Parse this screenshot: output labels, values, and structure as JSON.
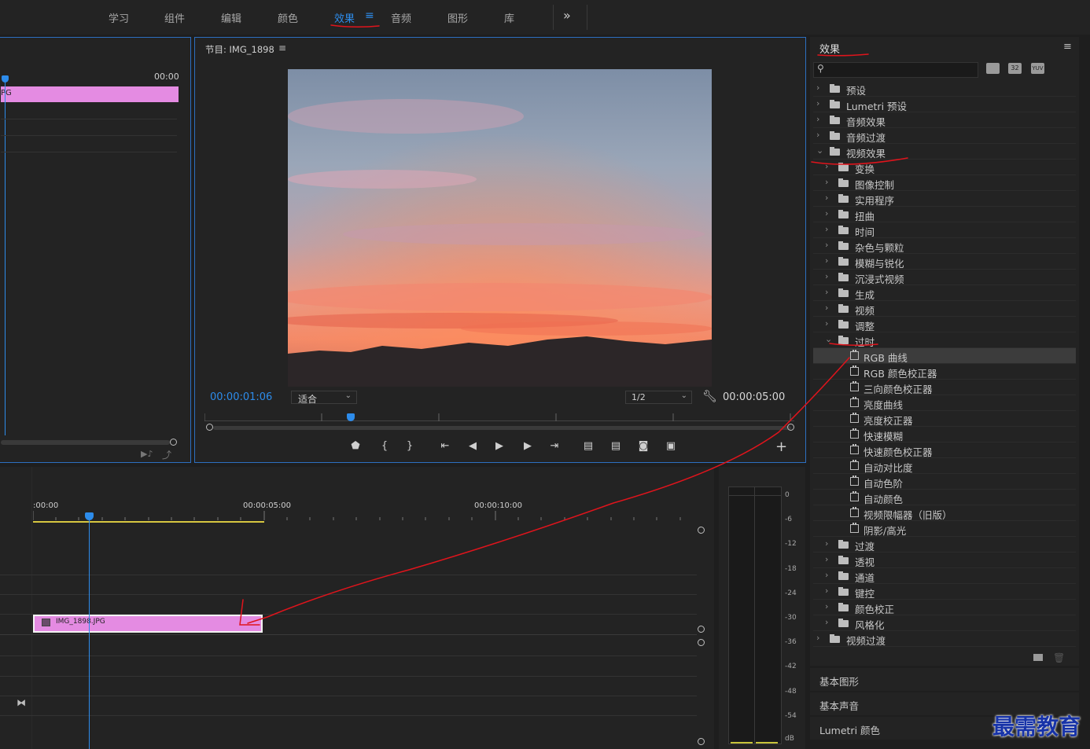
{
  "workspace_tabs": [
    "学习",
    "组件",
    "编辑",
    "颜色",
    "效果",
    "音频",
    "图形",
    "库"
  ],
  "workspace_more": "»",
  "workspace_active_icon": "≡",
  "source": {
    "timecode": "00:00",
    "clip_label": "PG"
  },
  "program": {
    "title": "节目: IMG_1898",
    "menu": "≡",
    "timecode_current": "00:00:01:06",
    "fit": "适合",
    "resolution": "1/2",
    "timecode_total": "00:00:05:00",
    "add": "+"
  },
  "timeline": {
    "ticks": [
      ":00:00",
      "00:00:05:00",
      "00:00:10:00"
    ],
    "clip_label": "IMG_1898.JPG"
  },
  "meter": {
    "labels": [
      "0",
      "-6",
      "-12",
      "-18",
      "-24",
      "-30",
      "-36",
      "-42",
      "-48",
      "-54",
      "dB"
    ]
  },
  "effects": {
    "title": "效果",
    "menu": "≡",
    "badges": [
      "32",
      "YUV"
    ],
    "tree": [
      {
        "label": "预设",
        "level": 0,
        "type": "folder-star",
        "open": false
      },
      {
        "label": "Lumetri 预设",
        "level": 0,
        "type": "folder-star",
        "open": false
      },
      {
        "label": "音频效果",
        "level": 0,
        "type": "folder",
        "open": false
      },
      {
        "label": "音频过渡",
        "level": 0,
        "type": "folder",
        "open": false
      },
      {
        "label": "视频效果",
        "level": 0,
        "type": "folder",
        "open": true
      },
      {
        "label": "变换",
        "level": 1,
        "type": "folder",
        "open": false
      },
      {
        "label": "图像控制",
        "level": 1,
        "type": "folder",
        "open": false
      },
      {
        "label": "实用程序",
        "level": 1,
        "type": "folder",
        "open": false
      },
      {
        "label": "扭曲",
        "level": 1,
        "type": "folder",
        "open": false
      },
      {
        "label": "时间",
        "level": 1,
        "type": "folder",
        "open": false
      },
      {
        "label": "杂色与颗粒",
        "level": 1,
        "type": "folder",
        "open": false
      },
      {
        "label": "模糊与锐化",
        "level": 1,
        "type": "folder",
        "open": false
      },
      {
        "label": "沉浸式视频",
        "level": 1,
        "type": "folder",
        "open": false
      },
      {
        "label": "生成",
        "level": 1,
        "type": "folder",
        "open": false
      },
      {
        "label": "视频",
        "level": 1,
        "type": "folder",
        "open": false
      },
      {
        "label": "调整",
        "level": 1,
        "type": "folder",
        "open": false
      },
      {
        "label": "过时",
        "level": 1,
        "type": "folder",
        "open": true
      },
      {
        "label": "RGB 曲线",
        "level": 2,
        "type": "fx",
        "selected": true
      },
      {
        "label": "RGB 颜色校正器",
        "level": 2,
        "type": "fx"
      },
      {
        "label": "三向颜色校正器",
        "level": 2,
        "type": "fx"
      },
      {
        "label": "亮度曲线",
        "level": 2,
        "type": "fx"
      },
      {
        "label": "亮度校正器",
        "level": 2,
        "type": "fx"
      },
      {
        "label": "快速模糊",
        "level": 2,
        "type": "fx"
      },
      {
        "label": "快速颜色校正器",
        "level": 2,
        "type": "fx"
      },
      {
        "label": "自动对比度",
        "level": 2,
        "type": "fx"
      },
      {
        "label": "自动色阶",
        "level": 2,
        "type": "fx"
      },
      {
        "label": "自动颜色",
        "level": 2,
        "type": "fx"
      },
      {
        "label": "视频限幅器（旧版）",
        "level": 2,
        "type": "fx"
      },
      {
        "label": "阴影/高光",
        "level": 2,
        "type": "fx"
      },
      {
        "label": "过渡",
        "level": 1,
        "type": "folder",
        "open": false
      },
      {
        "label": "透视",
        "level": 1,
        "type": "folder",
        "open": false
      },
      {
        "label": "通道",
        "level": 1,
        "type": "folder",
        "open": false
      },
      {
        "label": "键控",
        "level": 1,
        "type": "folder",
        "open": false
      },
      {
        "label": "颜色校正",
        "level": 1,
        "type": "folder",
        "open": false
      },
      {
        "label": "风格化",
        "level": 1,
        "type": "folder",
        "open": false
      },
      {
        "label": "视频过渡",
        "level": 0,
        "type": "folder",
        "open": false
      }
    ],
    "sections": [
      "基本图形",
      "基本声音",
      "Lumetri 颜色"
    ]
  },
  "watermark": "最需教育",
  "colors": {
    "accent": "#2d8ceb",
    "clip": "#e37fe0",
    "annotation": "#e0141c",
    "work_area": "#d6c640"
  }
}
